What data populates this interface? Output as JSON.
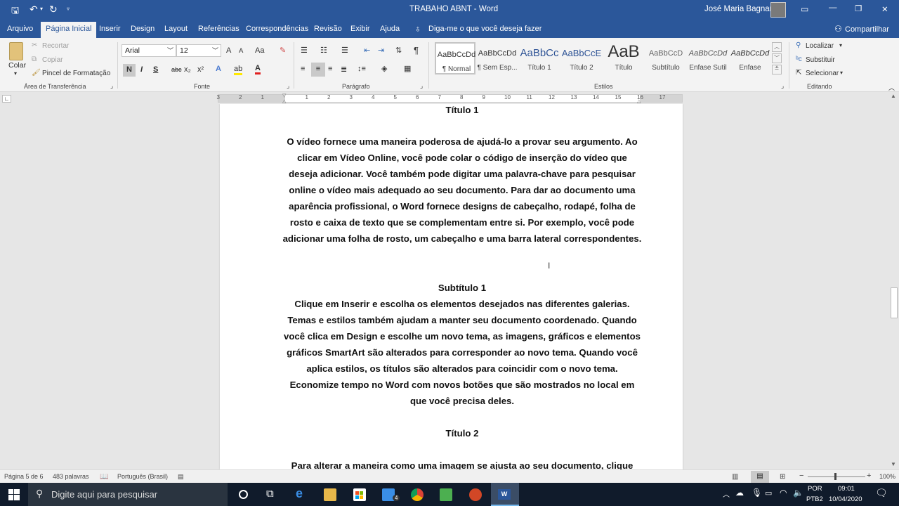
{
  "titlebar": {
    "doc_title": "TRABAHO ABNT  -  Word",
    "user_name": "José Maria Bagnara",
    "min_glyph": "—",
    "restore_glyph": "❐",
    "close_glyph": "✕"
  },
  "tabs": [
    {
      "label": "Arquivo"
    },
    {
      "label": "Página Inicial"
    },
    {
      "label": "Inserir"
    },
    {
      "label": "Design"
    },
    {
      "label": "Layout"
    },
    {
      "label": "Referências"
    },
    {
      "label": "Correspondências"
    },
    {
      "label": "Revisão"
    },
    {
      "label": "Exibir"
    },
    {
      "label": "Ajuda"
    }
  ],
  "tell_me": "Diga-me o que você deseja fazer",
  "share": "Compartilhar",
  "clipboard": {
    "paste": "Colar",
    "cut": "Recortar",
    "copy": "Copiar",
    "format_painter": "Pincel de Formatação",
    "group": "Área de Transferência"
  },
  "font": {
    "name": "Arial",
    "size": "12",
    "group": "Fonte",
    "bold": "N",
    "italic": "I",
    "underline": "S",
    "strike": "abc",
    "subscript": "x₂",
    "superscript": "x²",
    "grow": "A",
    "shrink": "A",
    "case": "Aa"
  },
  "paragraph": {
    "group": "Parágrafo",
    "pilcrow": "¶"
  },
  "styles": {
    "group": "Estilos",
    "items": [
      {
        "preview": "AaBbCcDd",
        "name": "¶ Normal"
      },
      {
        "preview": "AaBbCcDd",
        "name": "¶ Sem Esp..."
      },
      {
        "preview": "AaBbCc",
        "name": "Título 1"
      },
      {
        "preview": "AaBbCcE",
        "name": "Título 2"
      },
      {
        "preview": "AaB",
        "name": "Título"
      },
      {
        "preview": "AaBbCcD",
        "name": "Subtítulo"
      },
      {
        "preview": "AaBbCcDd",
        "name": "Ênfase Sutil"
      },
      {
        "preview": "AaBbCcDd",
        "name": "Ênfase"
      }
    ]
  },
  "editing": {
    "group": "Editando",
    "find": "Localizar",
    "replace": "Substituir",
    "select": "Selecionar"
  },
  "ruler_numbers": [
    "3",
    "2",
    "1",
    "1",
    "2",
    "3",
    "4",
    "5",
    "6",
    "7",
    "8",
    "9",
    "10",
    "11",
    "12",
    "13",
    "14",
    "15",
    "16",
    "17"
  ],
  "document": {
    "title1": "Título 1",
    "p1": "O vídeo fornece uma maneira poderosa de ajudá-lo a provar seu argumento. Ao clicar em Vídeo Online, você pode colar o código de inserção do vídeo que deseja adicionar. Você também pode digitar uma palavra-chave para pesquisar online o vídeo mais adequado ao seu documento. Para dar ao documento uma aparência profissional, o Word fornece designs de cabeçalho, rodapé, folha de rosto e caixa de texto que se complementam entre si. Por exemplo, você pode adicionar uma folha de rosto, um cabeçalho e uma barra lateral correspondentes.",
    "subtitle1": "Subtítulo 1",
    "p2": "Clique em Inserir e escolha os elementos desejados nas diferentes galerias. Temas e estilos também ajudam a manter seu documento coordenado. Quando você clica em Design e escolhe um novo tema, as imagens, gráficos e elementos gráficos SmartArt são alterados para corresponder ao novo tema. Quando você aplica estilos, os títulos são alterados para coincidir com o novo tema. Economize tempo no Word com novos botões que são mostrados no local em que você precisa deles.",
    "title2": "Título 2",
    "p3": "Para alterar a maneira como uma imagem se ajusta ao seu documento, clique"
  },
  "status": {
    "page": "Página 5 de 6",
    "words": "483 palavras",
    "language": "Português (Brasil)",
    "zoom": "100%"
  },
  "taskbar": {
    "search_placeholder": "Digite aqui para pesquisar",
    "lang1": "POR",
    "lang2": "PTB2",
    "time": "09:01",
    "date": "10/04/2020",
    "mail_badge": "4"
  }
}
